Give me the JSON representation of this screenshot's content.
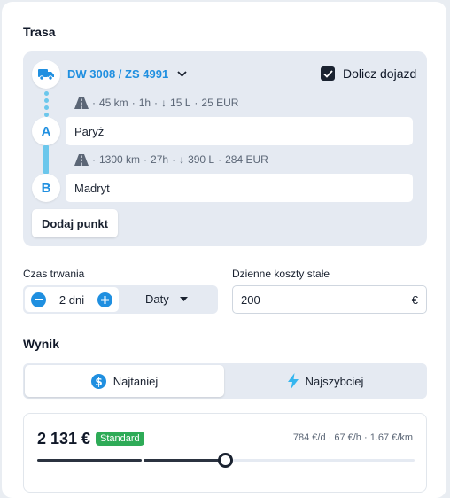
{
  "route_section": {
    "heading": "Trasa",
    "vehicle": "DW 3008 / ZS 4991",
    "include_commute": {
      "label": "Dolicz dojazd",
      "checked": true
    },
    "leg1": {
      "distance": "45 km",
      "time": "1h",
      "fuel": "15 L",
      "cost": "25 EUR"
    },
    "point_a": {
      "letter": "A",
      "value": "Paryż"
    },
    "leg2": {
      "distance": "1300 km",
      "time": "27h",
      "fuel": "390 L",
      "cost": "284 EUR"
    },
    "point_b": {
      "letter": "B",
      "value": "Madryt"
    },
    "add_point": "Dodaj punkt"
  },
  "duration": {
    "label": "Czas trwania",
    "value": "2 dni",
    "mode": "Daty"
  },
  "daily_costs": {
    "label": "Dzienne koszty stałe",
    "value": "200",
    "currency": "€"
  },
  "result": {
    "heading": "Wynik",
    "tabs": [
      {
        "label": "Najtaniej",
        "icon": "dollar-icon",
        "active": true
      },
      {
        "label": "Najszybciej",
        "icon": "lightning-icon",
        "active": false
      }
    ],
    "price": "2 131 €",
    "badge": "Standard",
    "rates": "784 €/d · 67 €/h · 1.67 €/km",
    "slider_fraction": 0.5
  },
  "colors": {
    "accent": "#1f8fe0",
    "route_line": "#6bc7ec",
    "badge_green": "#2eab57",
    "lightning": "#35b6ef"
  }
}
